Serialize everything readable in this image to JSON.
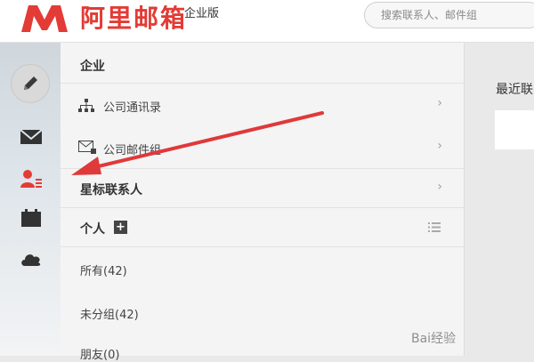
{
  "header": {
    "logo_letter": "M",
    "brand": "阿里邮箱",
    "edition": "企业版",
    "search_placeholder": "搜索联系人、邮件组"
  },
  "rail": {
    "items": [
      "compose-icon",
      "mail-icon",
      "contacts-icon",
      "calendar-icon",
      "cloud-icon"
    ],
    "active": "contacts-icon"
  },
  "panel": {
    "enterprise": {
      "title": "企业",
      "items": [
        {
          "label": "公司通讯录",
          "icon": "org-chart-icon"
        },
        {
          "label": "公司邮件组",
          "icon": "mail-group-icon"
        }
      ]
    },
    "starred": {
      "title": "星标联系人"
    },
    "personal": {
      "title": "个人",
      "items": [
        "所有(42)",
        "未分组(42)",
        "朋友(0)"
      ]
    }
  },
  "right": {
    "recent_title": "最近联"
  },
  "watermark": "Bai经验",
  "colors": {
    "brand": "#e33b36",
    "annotation_arrow": "#e0393a"
  }
}
